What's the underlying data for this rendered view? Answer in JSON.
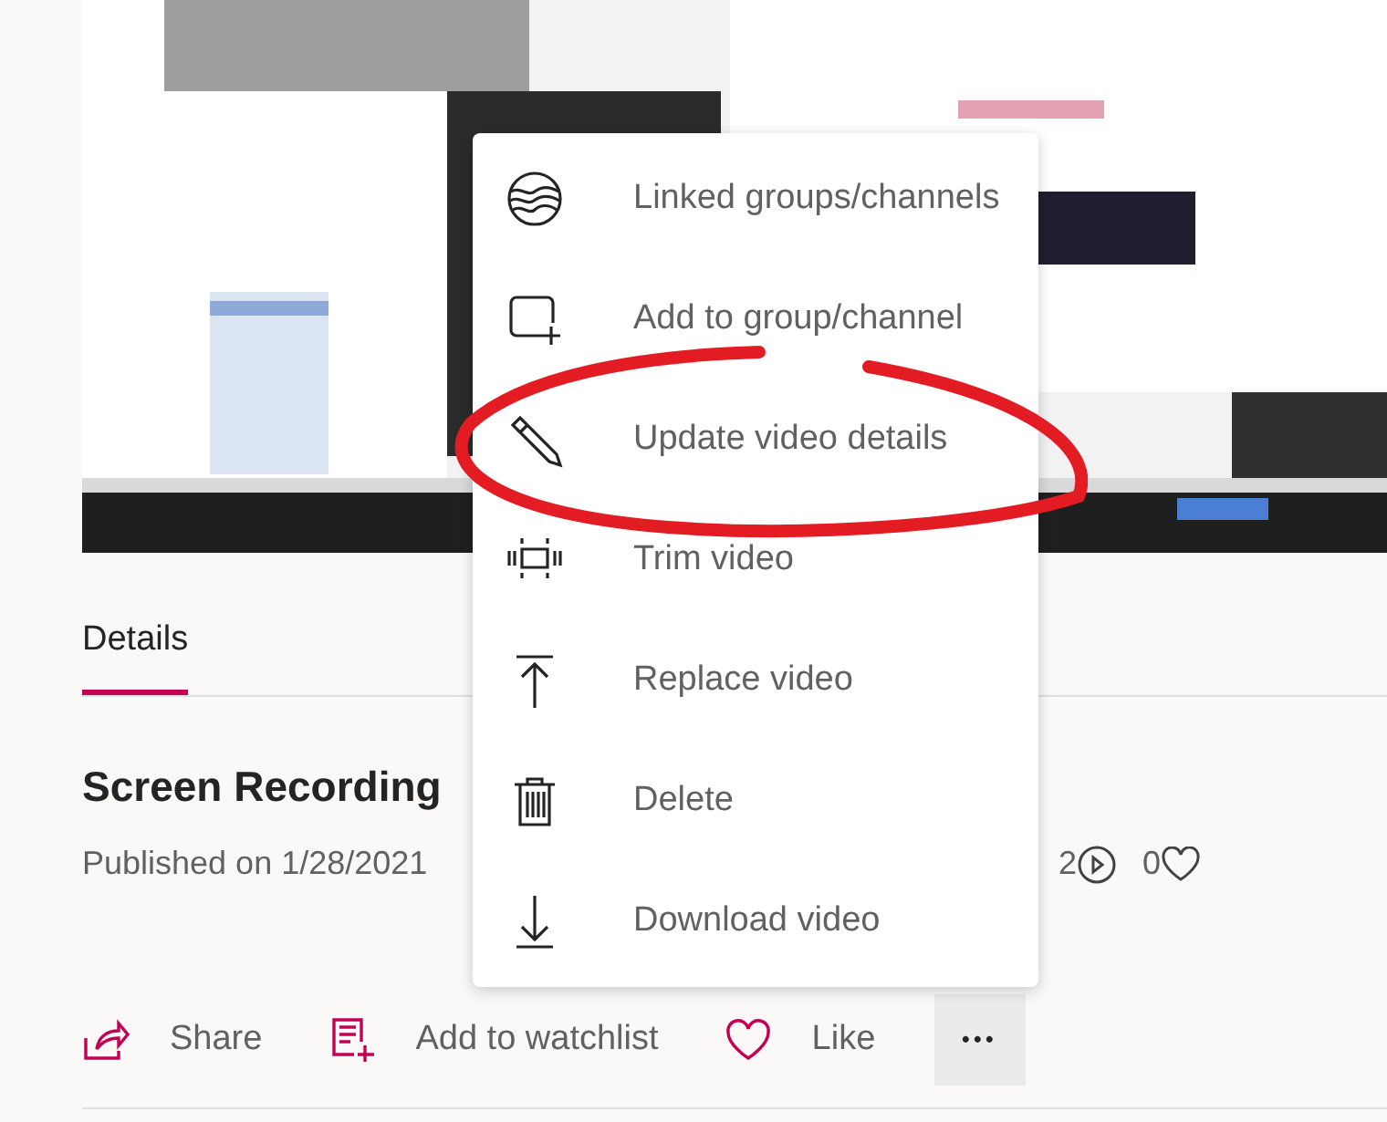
{
  "tabs": [
    {
      "label": "Details",
      "selected": true
    }
  ],
  "title": "Screen Recording",
  "published": "Published on 1/28/2021",
  "stats": [
    {
      "kind": "views",
      "value": "2"
    },
    {
      "kind": "likes",
      "value": "0"
    }
  ],
  "actions": [
    {
      "kind": "share",
      "label": "Share"
    },
    {
      "kind": "watchlist",
      "label": "Add to watchlist"
    },
    {
      "kind": "like",
      "label": "Like"
    }
  ],
  "more_button": {
    "label": "•••",
    "expanded": true
  },
  "menu": [
    {
      "kind": "linked",
      "label": "Linked groups/channels"
    },
    {
      "kind": "add",
      "label": "Add to group/channel"
    },
    {
      "kind": "edit",
      "label": "Update video details"
    },
    {
      "kind": "trim",
      "label": "Trim video"
    },
    {
      "kind": "replace",
      "label": "Replace video"
    },
    {
      "kind": "delete",
      "label": "Delete"
    },
    {
      "kind": "download",
      "label": "Download video"
    }
  ],
  "annotation": {
    "kind": "ellipse",
    "color": "#e31b23"
  }
}
